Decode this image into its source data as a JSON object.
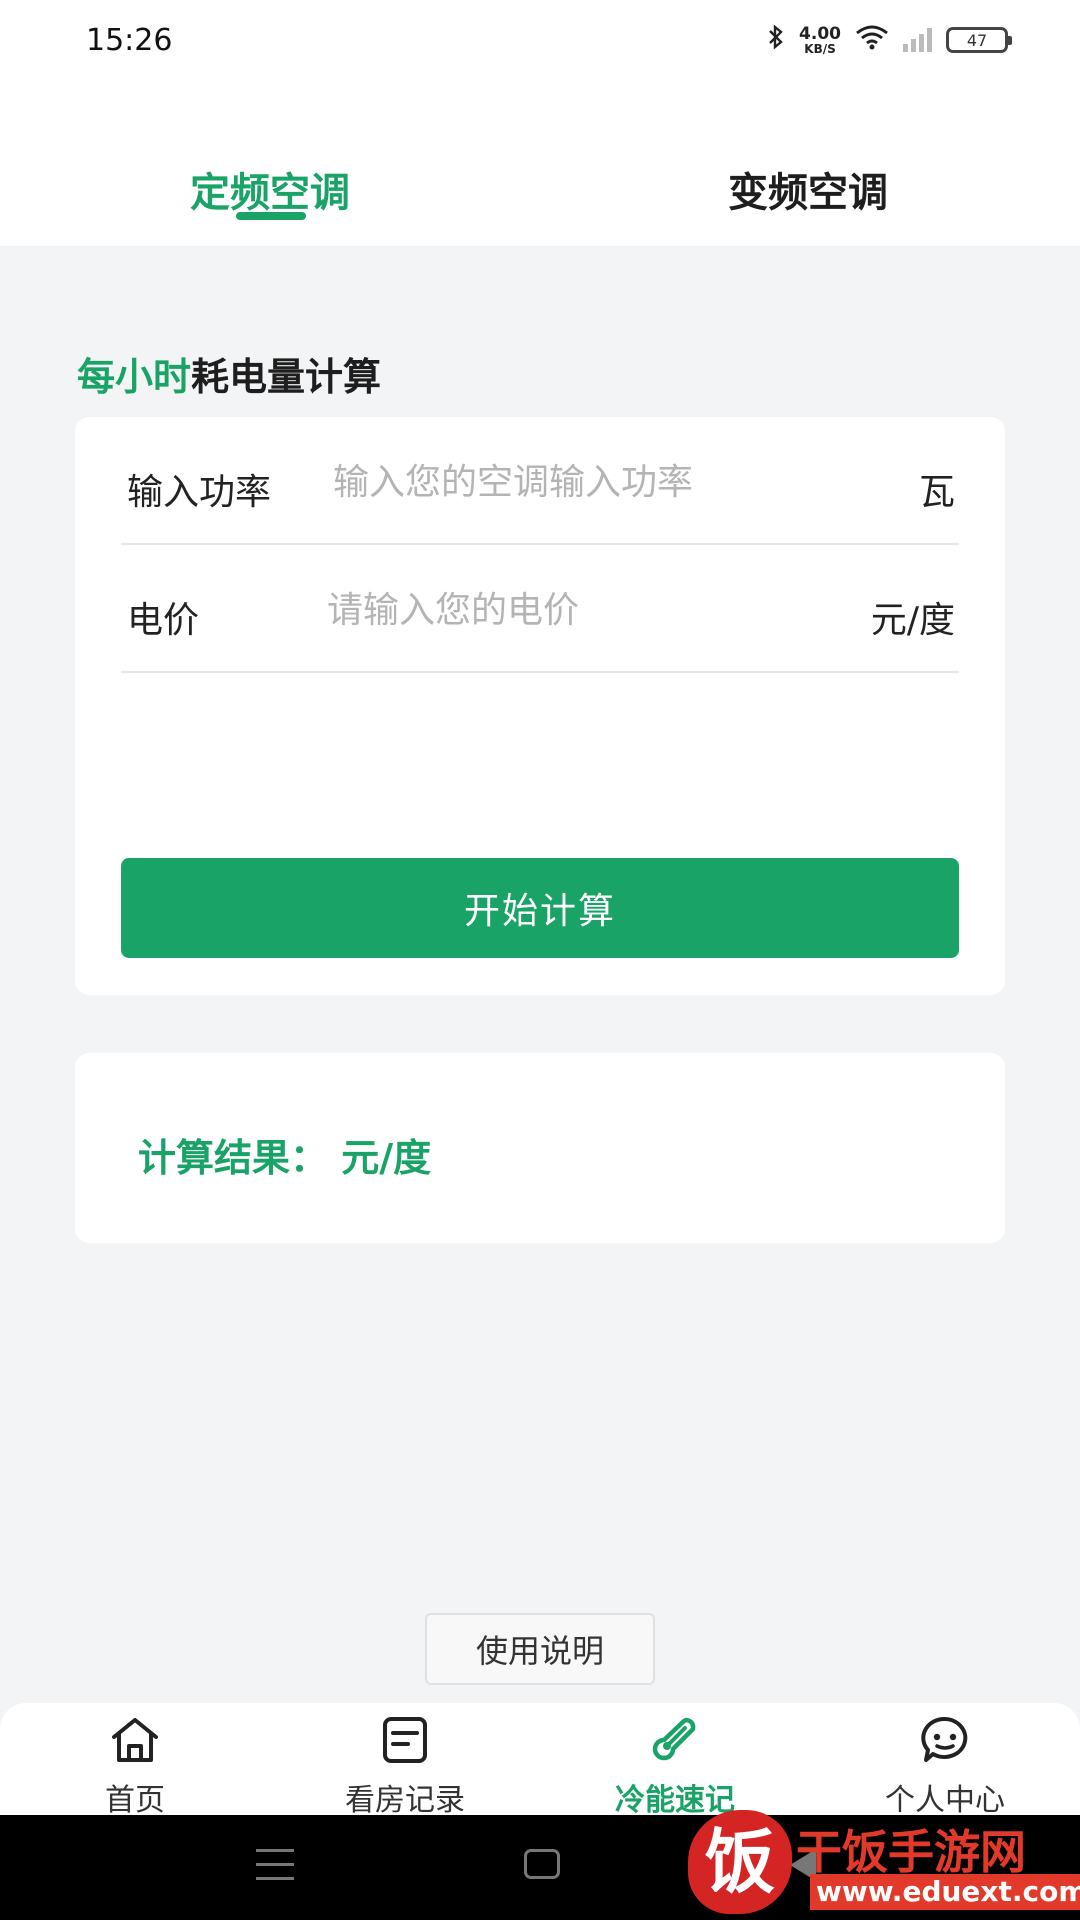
{
  "status_bar": {
    "time": "15:26",
    "net_speed_value": "4.00",
    "net_speed_unit": "KB/S",
    "battery": "47",
    "icons": [
      "bluetooth-icon",
      "wifi-icon",
      "signal-icon",
      "battery-icon"
    ]
  },
  "tabs": [
    {
      "label": "定频空调",
      "active": true
    },
    {
      "label": "变频空调",
      "active": false
    }
  ],
  "section": {
    "title_highlight": "每小时",
    "title_rest": "耗电量计算"
  },
  "form": {
    "power_label": "输入功率",
    "power_placeholder": "输入您的空调输入功率",
    "power_value": "",
    "power_unit": "瓦",
    "price_label": "电价",
    "price_placeholder": "请输入您的电价",
    "price_value": "",
    "price_unit": "元/度",
    "submit_label": "开始计算"
  },
  "result": {
    "text": "计算结果：  元/度"
  },
  "help_button": "使用说明",
  "bottom_nav": [
    {
      "label": "首页",
      "icon": "home-icon",
      "active": false
    },
    {
      "label": "看房记录",
      "icon": "note-icon",
      "active": false
    },
    {
      "label": "冷能速记",
      "icon": "thermometer-icon",
      "active": true
    },
    {
      "label": "个人中心",
      "icon": "profile-icon",
      "active": false
    }
  ],
  "watermark": {
    "mark": "饭",
    "name": "干饭手游网",
    "url": "www.eduext.com"
  },
  "colors": {
    "accent": "#1aa366",
    "page_background": "#f3f4f6",
    "watermark_red": "#e23a2a"
  }
}
